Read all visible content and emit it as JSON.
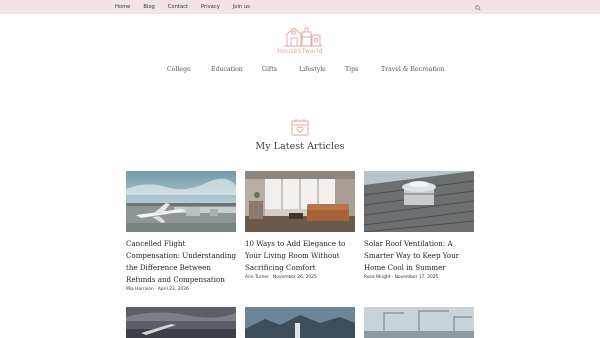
{
  "topnav": {
    "items": [
      {
        "label": "Home"
      },
      {
        "label": "Blog"
      },
      {
        "label": "Contact"
      },
      {
        "label": "Privacy"
      },
      {
        "label": "Join us"
      }
    ],
    "search_icon": "search-icon"
  },
  "logo": {
    "text": "HouseSTwarld"
  },
  "categories": [
    {
      "label": "College"
    },
    {
      "label": "Education"
    },
    {
      "label": "Gifts"
    },
    {
      "label": "Lifestyle"
    },
    {
      "label": "Tips"
    },
    {
      "label": "Travel & Recreation"
    }
  ],
  "section": {
    "title": "My Latest Articles",
    "icon": "calendar-heart-icon"
  },
  "articles": [
    {
      "title": "Cancelled Flight Compensation: Understanding the Difference Between Refunds and Compensation",
      "author": "Mia Harrison",
      "date": "April 23, 2026"
    },
    {
      "title": "10 Ways to Add Elegance to Your Living Room Without Sacrificing Comfort",
      "author": "Ann Turner",
      "date": "November 26, 2025"
    },
    {
      "title": "Solar Roof Ventilation: A Smarter Way to Keep Your Home Cool in Summer",
      "author": "Rose Wright",
      "date": "November 17, 2025"
    }
  ],
  "colors": {
    "topbar": "#f1e4e3",
    "accent": "#e8a19a"
  }
}
